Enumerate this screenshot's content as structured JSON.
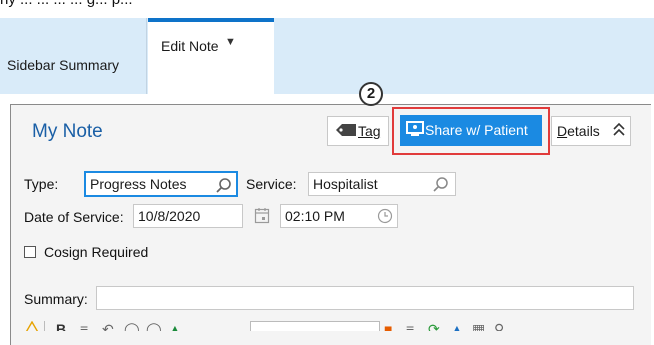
{
  "top_text": "ny ... ... ... ... g... p...",
  "tabs": [
    {
      "label": "Sidebar Summary"
    },
    {
      "label": "Edit Note",
      "active": true
    }
  ],
  "note": {
    "title": "My Note",
    "badge": "2",
    "buttons": {
      "tag": "Tag",
      "share": "Share w/ Patient",
      "details": "Details"
    },
    "fields": {
      "type_label": "Type:",
      "type_value": "Progress Notes",
      "service_label": "Service:",
      "service_value": "Hospitalist",
      "date_label": "Date of Service:",
      "date_value": "10/8/2020",
      "time_value": "02:10 PM",
      "cosign_label": "Cosign Required",
      "summary_label": "Summary:",
      "summary_value": ""
    }
  },
  "colors": {
    "tabbar_bg": "#d9ebf9",
    "accent": "#1b8ae2",
    "title": "#1a5fa6",
    "highlight_outline": "#e13b3b"
  },
  "icons": [
    "tag-icon",
    "share-monitor-icon",
    "chevrons-up-icon",
    "search-icon",
    "calendar-icon",
    "clock-icon",
    "chevron-down-icon"
  ]
}
